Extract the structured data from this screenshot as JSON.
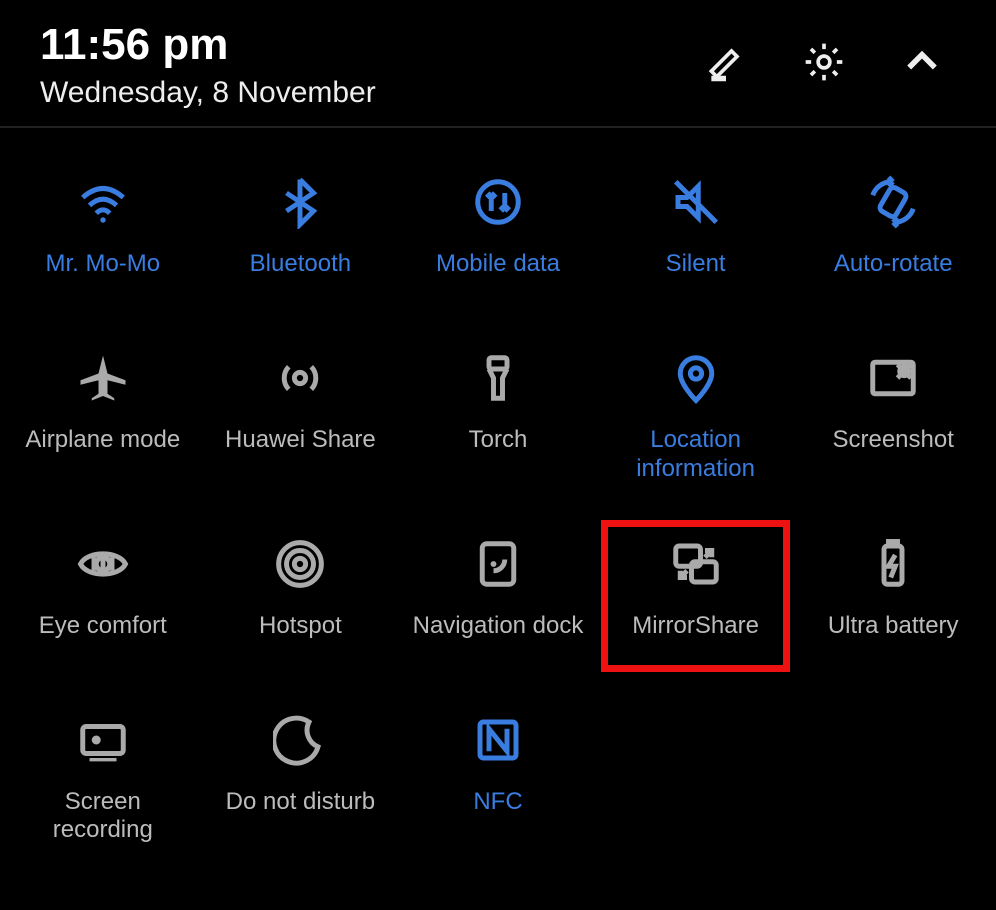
{
  "header": {
    "time": "11:56 pm",
    "date": "Wednesday, 8 November"
  },
  "colors": {
    "active": "#3a7de0",
    "inactive": "#aaaaaa",
    "highlight": "#ee1111"
  },
  "tiles": [
    {
      "id": "wifi",
      "label": "Mr. Mo-Mo",
      "icon": "wifi-icon",
      "state": "active"
    },
    {
      "id": "bluetooth",
      "label": "Bluetooth",
      "icon": "bluetooth-icon",
      "state": "active"
    },
    {
      "id": "mobile-data",
      "label": "Mobile data",
      "icon": "mobile-data-icon",
      "state": "active"
    },
    {
      "id": "silent",
      "label": "Silent",
      "icon": "silent-icon",
      "state": "active"
    },
    {
      "id": "auto-rotate",
      "label": "Auto-rotate",
      "icon": "auto-rotate-icon",
      "state": "active"
    },
    {
      "id": "airplane",
      "label": "Airplane mode",
      "icon": "airplane-icon",
      "state": "inactive"
    },
    {
      "id": "huawei-share",
      "label": "Huawei Share",
      "icon": "huawei-share-icon",
      "state": "inactive"
    },
    {
      "id": "torch",
      "label": "Torch",
      "icon": "torch-icon",
      "state": "inactive"
    },
    {
      "id": "location",
      "label": "Location information",
      "icon": "location-icon",
      "state": "active"
    },
    {
      "id": "screenshot",
      "label": "Screenshot",
      "icon": "screenshot-icon",
      "state": "inactive"
    },
    {
      "id": "eye-comfort",
      "label": "Eye comfort",
      "icon": "eye-comfort-icon",
      "state": "inactive"
    },
    {
      "id": "hotspot",
      "label": "Hotspot",
      "icon": "hotspot-icon",
      "state": "inactive"
    },
    {
      "id": "nav-dock",
      "label": "Navigation dock",
      "icon": "nav-dock-icon",
      "state": "inactive"
    },
    {
      "id": "mirrorshare",
      "label": "MirrorShare",
      "icon": "mirrorshare-icon",
      "state": "inactive",
      "highlighted": true
    },
    {
      "id": "ultra-battery",
      "label": "Ultra battery",
      "icon": "ultra-battery-icon",
      "state": "inactive"
    },
    {
      "id": "screen-rec",
      "label": "Screen recording",
      "icon": "screen-rec-icon",
      "state": "inactive"
    },
    {
      "id": "dnd",
      "label": "Do not disturb",
      "icon": "dnd-icon",
      "state": "inactive"
    },
    {
      "id": "nfc",
      "label": "NFC",
      "icon": "nfc-icon",
      "state": "active"
    }
  ]
}
